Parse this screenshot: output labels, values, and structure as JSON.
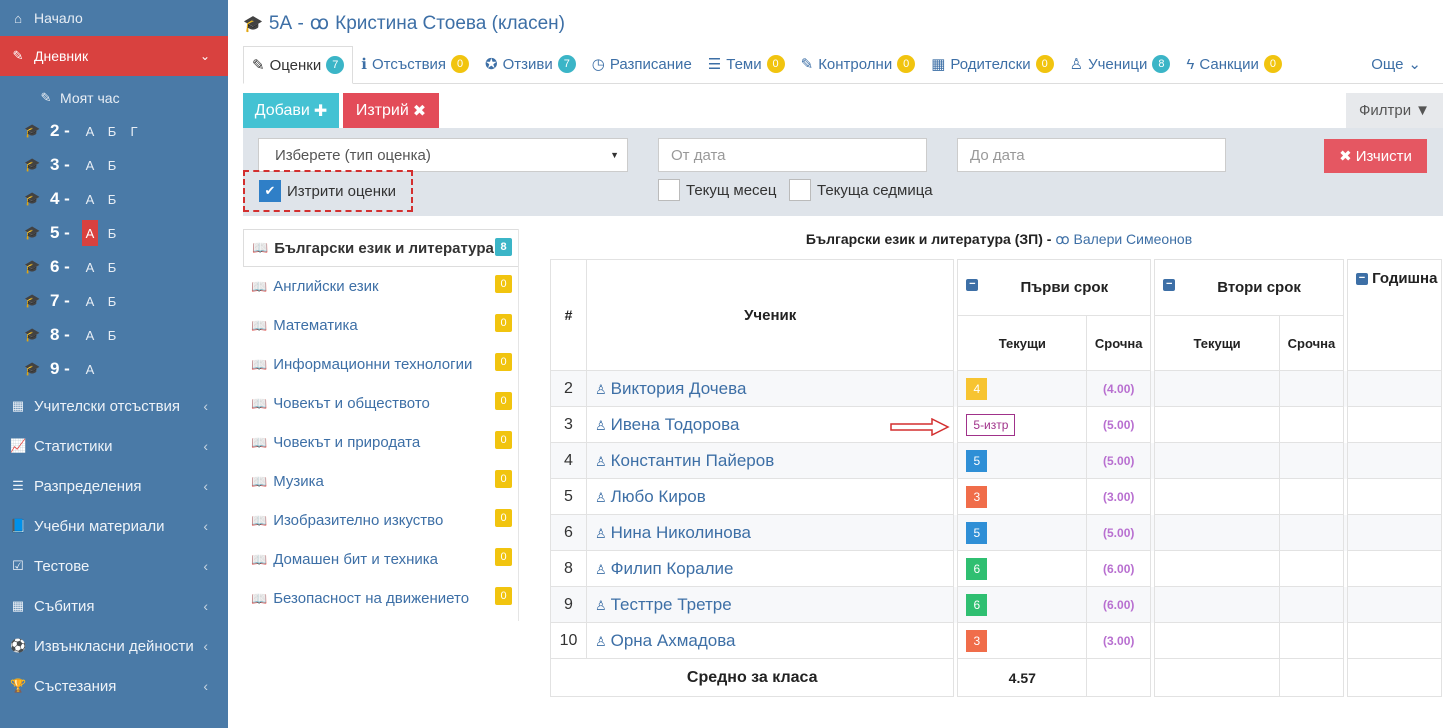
{
  "sidebar": {
    "home": "Начало",
    "diary": "Дневник",
    "my_hour": "Моят час",
    "classes": [
      {
        "num": "2 -",
        "letters": [
          "А",
          "Б",
          "Г"
        ],
        "active": -1
      },
      {
        "num": "3 -",
        "letters": [
          "А",
          "Б"
        ],
        "active": -1
      },
      {
        "num": "4 -",
        "letters": [
          "А",
          "Б"
        ],
        "active": -1
      },
      {
        "num": "5 -",
        "letters": [
          "А",
          "Б"
        ],
        "active": 0
      },
      {
        "num": "6 -",
        "letters": [
          "А",
          "Б"
        ],
        "active": -1
      },
      {
        "num": "7 -",
        "letters": [
          "А",
          "Б"
        ],
        "active": -1
      },
      {
        "num": "8 -",
        "letters": [
          "А",
          "Б"
        ],
        "active": -1
      },
      {
        "num": "9 -",
        "letters": [
          "А"
        ],
        "active": -1
      }
    ],
    "menu": [
      {
        "label": "Учителски отсъствия",
        "icon": "calendar-icon"
      },
      {
        "label": "Статистики",
        "icon": "chart-icon"
      },
      {
        "label": "Разпределения",
        "icon": "list-icon"
      },
      {
        "label": "Учебни материали",
        "icon": "book-icon"
      },
      {
        "label": "Тестове",
        "icon": "checkbox-icon"
      },
      {
        "label": "Събития",
        "icon": "calendar-icon"
      },
      {
        "label": "Извънкласни дейности",
        "icon": "ball-icon"
      },
      {
        "label": "Състезания",
        "icon": "trophy-icon"
      }
    ]
  },
  "header": {
    "class": "5А -",
    "teacher": "Кристина Стоева (класен)"
  },
  "tabs": [
    {
      "label": "Оценки",
      "badge": "7",
      "color": "teal",
      "icon": "pencil-icon"
    },
    {
      "label": "Отсъствия",
      "badge": "0",
      "color": "yellow",
      "icon": "info-icon"
    },
    {
      "label": "Отзиви",
      "badge": "7",
      "color": "teal",
      "icon": "award-icon"
    },
    {
      "label": "Разписание",
      "badge": "",
      "color": "",
      "icon": "clock-icon"
    },
    {
      "label": "Теми",
      "badge": "0",
      "color": "yellow",
      "icon": "list-icon"
    },
    {
      "label": "Контролни",
      "badge": "0",
      "color": "yellow",
      "icon": "edit-icon"
    },
    {
      "label": "Родителски",
      "badge": "0",
      "color": "yellow",
      "icon": "calendar-icon"
    },
    {
      "label": "Ученици",
      "badge": "8",
      "color": "teal",
      "icon": "child-icon"
    },
    {
      "label": "Санкции",
      "badge": "0",
      "color": "yellow",
      "icon": "bolt-icon"
    }
  ],
  "tab_more": "Още",
  "toolbar": {
    "add": "Добави",
    "delete": "Изтрий",
    "filters": "Филтри"
  },
  "filters": {
    "grade_type_placeholder": "Изберете (тип оценка)",
    "from_date": "От дата",
    "to_date": "До дата",
    "clear": "Изчисти",
    "deleted_grades": "Изтрити оценки",
    "current_month": "Текущ месец",
    "current_week": "Текуща седмица"
  },
  "subjects": [
    {
      "name": "Български език и литература",
      "count": "8",
      "color": "teal"
    },
    {
      "name": "Английски език",
      "count": "0",
      "color": "yellow"
    },
    {
      "name": "Математика",
      "count": "0",
      "color": "yellow"
    },
    {
      "name": "Информационни технологии",
      "count": "0",
      "color": "yellow"
    },
    {
      "name": "Човекът и обществото",
      "count": "0",
      "color": "yellow"
    },
    {
      "name": "Човекът и природата",
      "count": "0",
      "color": "yellow"
    },
    {
      "name": "Музика",
      "count": "0",
      "color": "yellow"
    },
    {
      "name": "Изобразително изкуство",
      "count": "0",
      "color": "yellow"
    },
    {
      "name": "Домашен бит и техника",
      "count": "0",
      "color": "yellow"
    },
    {
      "name": "Безопасност на движението",
      "count": "0",
      "color": "yellow"
    }
  ],
  "table": {
    "subject_title": "Български език и литература (ЗП) -",
    "teacher": "Валери Симеонов",
    "col_num": "#",
    "col_student": "Ученик",
    "term1": "Първи срок",
    "term2": "Втори срок",
    "yearly": "Годишна",
    "current": "Текущи",
    "term_grade": "Срочна",
    "rows": [
      {
        "num": "2",
        "name": "Виктория Дочева",
        "grade": "4",
        "color": "yellow",
        "term": "(4.00)"
      },
      {
        "num": "3",
        "name": "Ивена Тодорова",
        "grade": "5-изтр",
        "color": "deleted",
        "term": "(5.00)"
      },
      {
        "num": "4",
        "name": "Константин Пайеров",
        "grade": "5",
        "color": "blue",
        "term": "(5.00)"
      },
      {
        "num": "5",
        "name": "Любо Киров",
        "grade": "3",
        "color": "orange",
        "term": "(3.00)"
      },
      {
        "num": "6",
        "name": "Нина Николинова",
        "grade": "5",
        "color": "blue",
        "term": "(5.00)"
      },
      {
        "num": "8",
        "name": "Филип Коралие",
        "grade": "6",
        "color": "green",
        "term": "(6.00)"
      },
      {
        "num": "9",
        "name": "Тесттре Третре",
        "grade": "6",
        "color": "green",
        "term": "(6.00)"
      },
      {
        "num": "10",
        "name": "Орна Ахмадова",
        "grade": "3",
        "color": "orange",
        "term": "(3.00)"
      }
    ],
    "avg_label": "Средно за класа",
    "avg_value": "4.57"
  }
}
